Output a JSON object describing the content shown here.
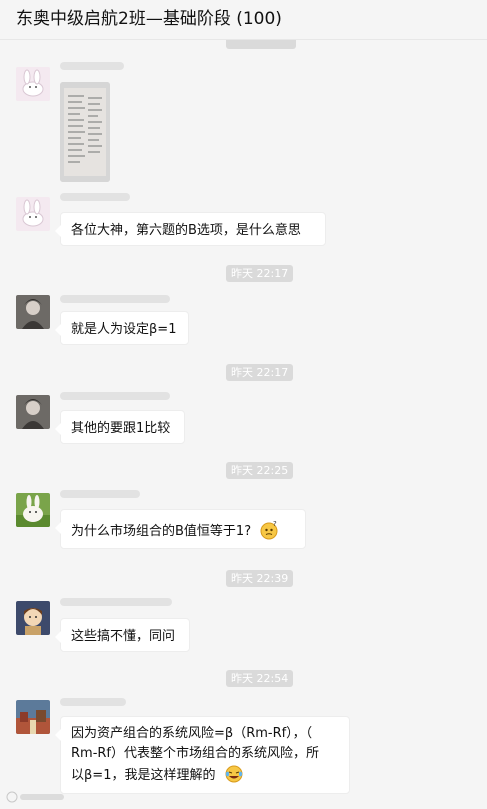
{
  "header": {
    "title": "东奥中级启航2班—基础阶段 (100)"
  },
  "messages": {
    "m2": {
      "text": "各位大神，第六题的B选项，是什么意思"
    },
    "t1": {
      "time": "昨天 22:17"
    },
    "m3": {
      "text": "就是人为设定β=1"
    },
    "t2": {
      "time": "昨天 22:17"
    },
    "m4": {
      "text": "其他的要跟1比较"
    },
    "t3": {
      "time": "昨天 22:25"
    },
    "m5": {
      "text": "为什么市场组合的B值恒等于1?"
    },
    "t4": {
      "time": "昨天 22:39"
    },
    "m6": {
      "text": "这些搞不懂，同问"
    },
    "t5": {
      "time": "昨天 22:54"
    },
    "m7": {
      "line1": "因为资产组合的系统风险=β（Rm-Rf），（",
      "line2": "Rm-Rf）代表整个市场组合的系统风险，所",
      "line3": "以β=1，我是这样理解的"
    }
  },
  "icons": {
    "emoji_thinking": "thinking-face-icon",
    "emoji_laugh": "laughing-tears-icon"
  }
}
